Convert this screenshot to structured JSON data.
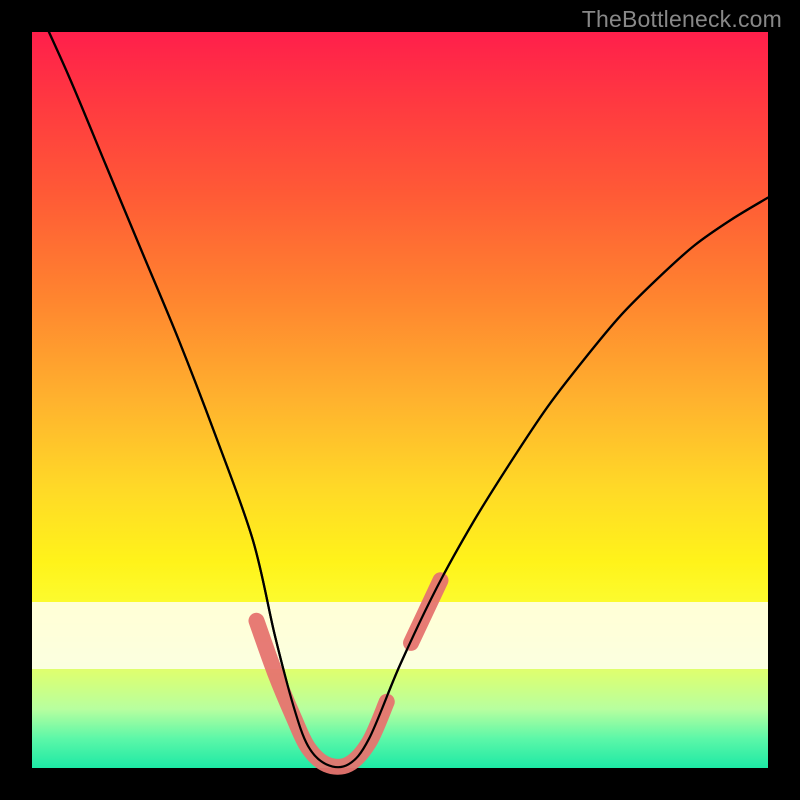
{
  "watermark": "TheBottleneck.com",
  "chart_data": {
    "type": "line",
    "title": "",
    "xlabel": "",
    "ylabel": "",
    "xlim": [
      0,
      1
    ],
    "ylim": [
      0,
      1
    ],
    "x": [
      0.0,
      0.05,
      0.1,
      0.15,
      0.2,
      0.25,
      0.3,
      0.33,
      0.355,
      0.375,
      0.4,
      0.43,
      0.458,
      0.5,
      0.55,
      0.6,
      0.65,
      0.7,
      0.75,
      0.8,
      0.85,
      0.9,
      0.95,
      1.0
    ],
    "values": [
      1.05,
      0.94,
      0.82,
      0.7,
      0.58,
      0.45,
      0.31,
      0.18,
      0.085,
      0.03,
      0.005,
      0.005,
      0.04,
      0.14,
      0.245,
      0.335,
      0.415,
      0.49,
      0.555,
      0.615,
      0.665,
      0.71,
      0.745,
      0.775
    ],
    "highlight_segments": [
      {
        "x": [
          0.305,
          0.33,
          0.355,
          0.375,
          0.4,
          0.43,
          0.458,
          0.482
        ],
        "y": [
          0.2,
          0.13,
          0.07,
          0.028,
          0.005,
          0.005,
          0.035,
          0.09
        ]
      },
      {
        "x": [
          0.515,
          0.555
        ],
        "y": [
          0.17,
          0.255
        ]
      }
    ],
    "white_band_y": [
      0.135,
      0.225
    ]
  },
  "colors": {
    "curve": "#000000",
    "highlight": "#e6746f",
    "band": "#fffff5"
  }
}
